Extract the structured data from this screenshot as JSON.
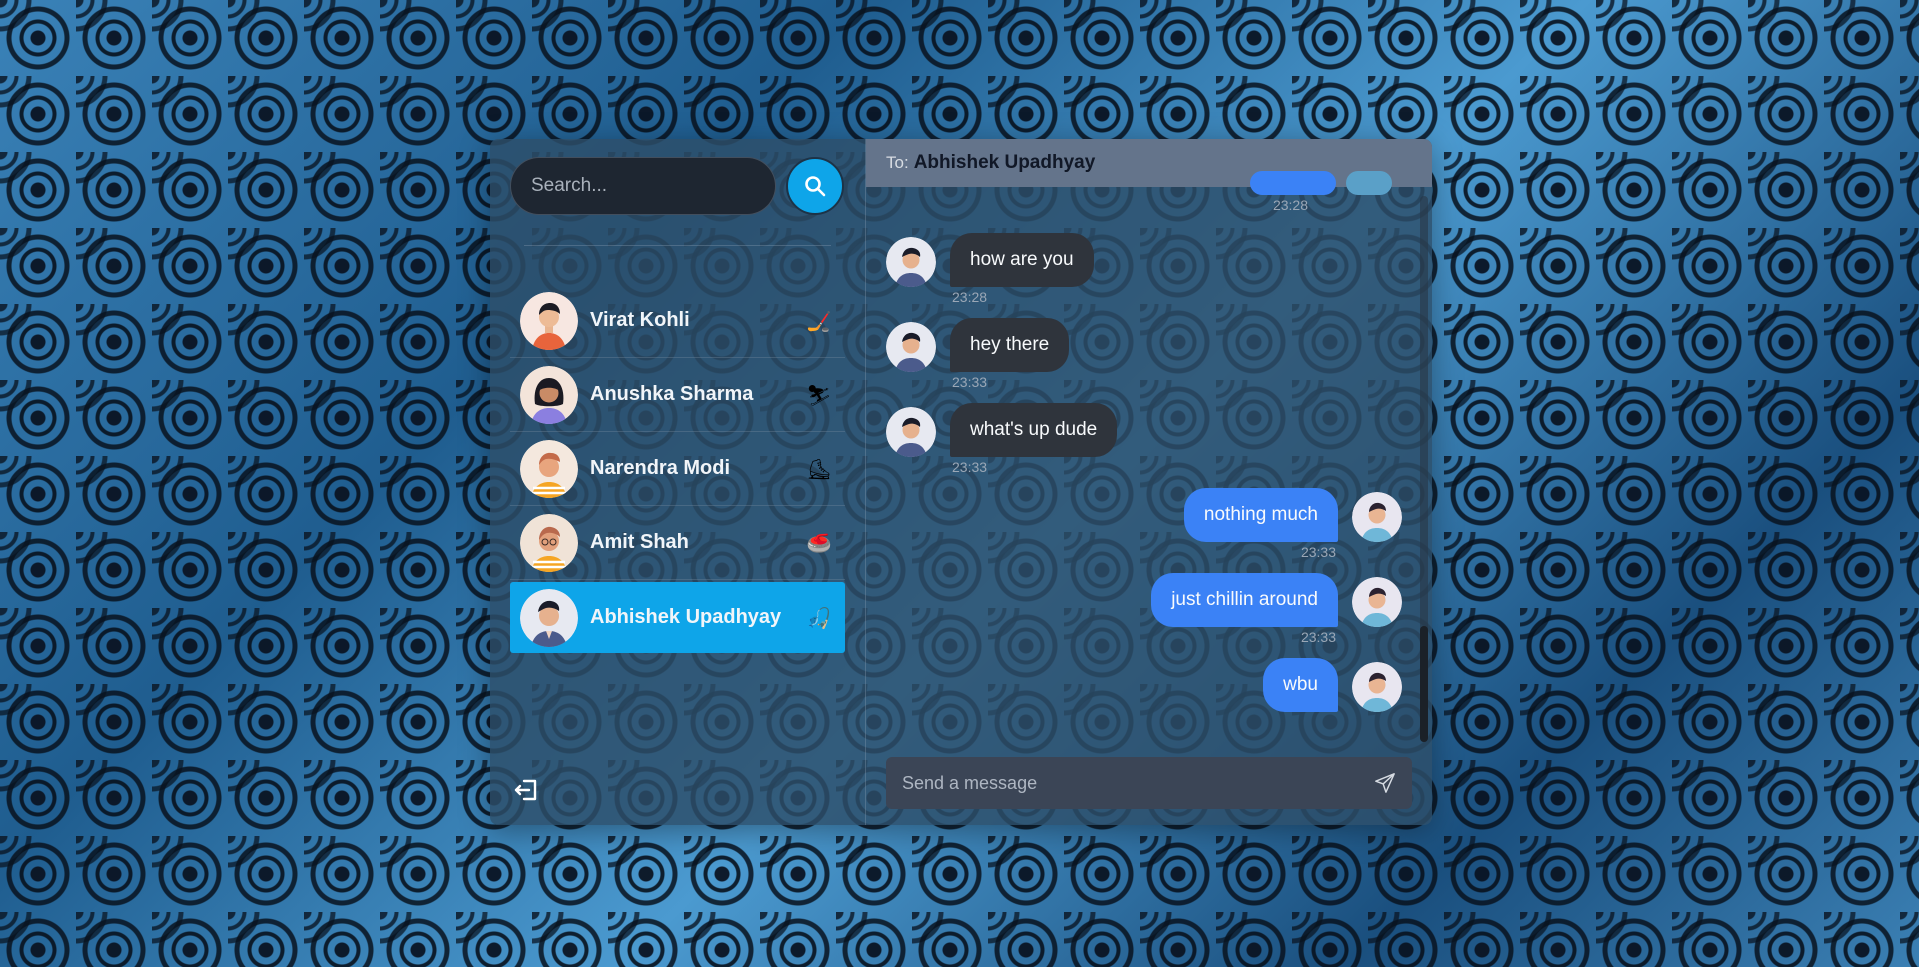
{
  "sidebar": {
    "search": {
      "placeholder": "Search..."
    },
    "contacts": [
      {
        "name": "Virat Kohli",
        "emoji": "🏒",
        "avatar_color": "#f5e6df",
        "active": false
      },
      {
        "name": "Anushka Sharma",
        "emoji": "⛷",
        "avatar_color": "#f1e3d9",
        "active": false
      },
      {
        "name": "Narendra Modi",
        "emoji": "⛸",
        "avatar_color": "#f3e6dc",
        "active": false
      },
      {
        "name": "Amit Shah",
        "emoji": "🥌",
        "avatar_color": "#efe2d6",
        "active": false
      },
      {
        "name": "Abhishek Upadhyay",
        "emoji": "🎣",
        "avatar_color": "#e6e8f0",
        "active": true
      }
    ]
  },
  "chat": {
    "header": {
      "to_label": "To:",
      "recipient": "Abhishek Upadhyay"
    },
    "top_partial_time": "23:28",
    "messages": [
      {
        "direction": "in",
        "text": "how are you",
        "time": "23:28"
      },
      {
        "direction": "in",
        "text": "hey there",
        "time": "23:33"
      },
      {
        "direction": "in",
        "text": "what's up dude",
        "time": "23:33"
      },
      {
        "direction": "out",
        "text": "nothing much",
        "time": "23:33"
      },
      {
        "direction": "out",
        "text": "just chillin around",
        "time": "23:33"
      },
      {
        "direction": "out",
        "text": "wbu",
        "time": ""
      }
    ],
    "composer": {
      "placeholder": "Send a message"
    }
  },
  "colors": {
    "accent": "#0ea5e9",
    "outgoing_bubble": "#3b82f6",
    "incoming_bubble": "#2f343c",
    "header_bg": "#64748b"
  }
}
